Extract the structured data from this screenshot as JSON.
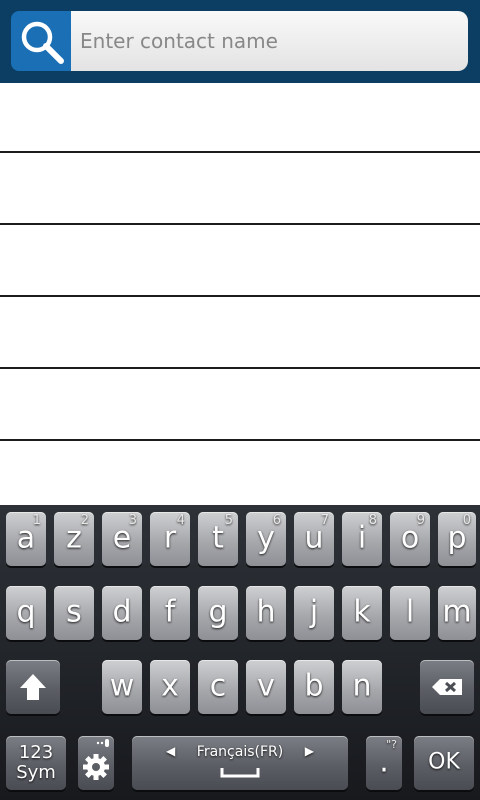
{
  "search": {
    "placeholder": "Enter contact name",
    "icon": "search-icon"
  },
  "contact_rows": 6,
  "keyboard": {
    "row1": [
      {
        "label": "a",
        "hint": "1"
      },
      {
        "label": "z",
        "hint": "2"
      },
      {
        "label": "e",
        "hint": "3"
      },
      {
        "label": "r",
        "hint": "4"
      },
      {
        "label": "t",
        "hint": "5"
      },
      {
        "label": "y",
        "hint": "6"
      },
      {
        "label": "u",
        "hint": "7"
      },
      {
        "label": "i",
        "hint": "8"
      },
      {
        "label": "o",
        "hint": "9"
      },
      {
        "label": "p",
        "hint": "0"
      }
    ],
    "row2": [
      "q",
      "s",
      "d",
      "f",
      "g",
      "h",
      "j",
      "k",
      "l",
      "m"
    ],
    "row3": [
      "w",
      "x",
      "c",
      "v",
      "b",
      "n"
    ],
    "shift_icon": "shift-arrow-icon",
    "backspace_icon": "backspace-icon",
    "sym_label_top": "123",
    "sym_label_bottom": "Sym",
    "settings_icon": "gear-icon",
    "settings_hint": "mic-icon",
    "space_language": "Français(FR)",
    "period_label": ".",
    "period_hint": "\"?",
    "ok_label": "OK"
  },
  "colors": {
    "header_bg": "#0c3e63",
    "search_button": "#1a6fb5",
    "keyboard_bg": "#1f2226"
  }
}
